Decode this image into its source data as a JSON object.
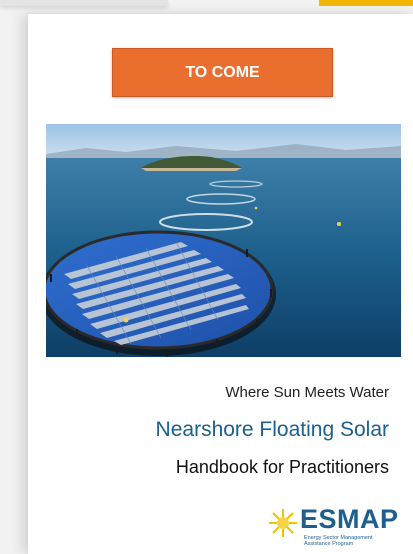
{
  "banner": {
    "label": "TO COME"
  },
  "cover": {
    "image_icon": "floating-solar-photo",
    "tagline": "Where Sun Meets Water",
    "title": "Nearshore Floating Solar",
    "subtitle": "Handbook for Practitioners"
  },
  "logo": {
    "name": "ESMAP",
    "subtitle_line1": "Energy Sector Management",
    "subtitle_line2": "Assistance Program",
    "icon": "sun-icon"
  },
  "colors": {
    "accent": "#EA6F2F",
    "title_blue": "#1B5F8D",
    "top_accent": "#F2B705"
  }
}
